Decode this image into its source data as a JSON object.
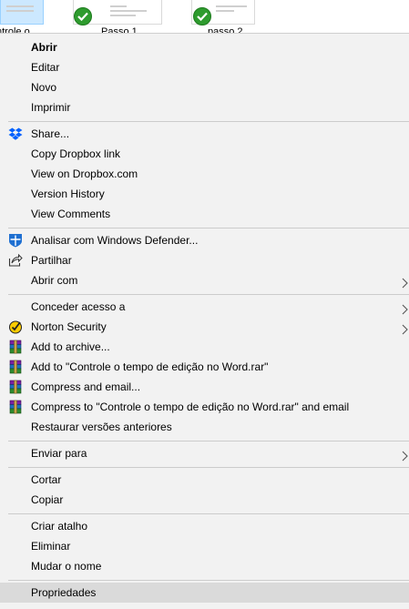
{
  "explorer": {
    "files": [
      {
        "name": "ntrole o",
        "selected": true
      },
      {
        "name": "Passo 1",
        "selected": false
      },
      {
        "name": "passo 2",
        "selected": false
      }
    ]
  },
  "menu": {
    "abrir": "Abrir",
    "editar": "Editar",
    "novo": "Novo",
    "imprimir": "Imprimir",
    "share": "Share...",
    "copy_link": "Copy Dropbox link",
    "view_dropbox": "View on Dropbox.com",
    "version_history": "Version History",
    "view_comments": "View Comments",
    "defender": "Analisar com Windows Defender...",
    "partilhar": "Partilhar",
    "abrir_com": "Abrir com",
    "conceder": "Conceder acesso a",
    "norton": "Norton Security",
    "add_archive": "Add to archive...",
    "add_rar": "Add to \"Controle o tempo de edição no Word.rar\"",
    "compress_email": "Compress and email...",
    "compress_rar_email": "Compress to \"Controle o tempo de edição no Word.rar\" and email",
    "restaurar": "Restaurar versões anteriores",
    "enviar_para": "Enviar para",
    "cortar": "Cortar",
    "copiar": "Copiar",
    "criar_atalho": "Criar atalho",
    "eliminar": "Eliminar",
    "mudar_nome": "Mudar o nome",
    "propriedades": "Propriedades"
  },
  "icons": {
    "dropbox": "dropbox-icon",
    "defender": "windows-defender-icon",
    "share": "share-icon",
    "norton": "norton-icon",
    "winrar": "winrar-icon",
    "submenu": "chevron-right-icon"
  },
  "colors": {
    "menu_bg": "#f2f2f2",
    "hover_bg": "#dadada",
    "separator": "#cccccc",
    "dropbox_blue": "#0061fe",
    "defender_blue": "#1e6fd1",
    "check_green": "#2e9b2e"
  }
}
